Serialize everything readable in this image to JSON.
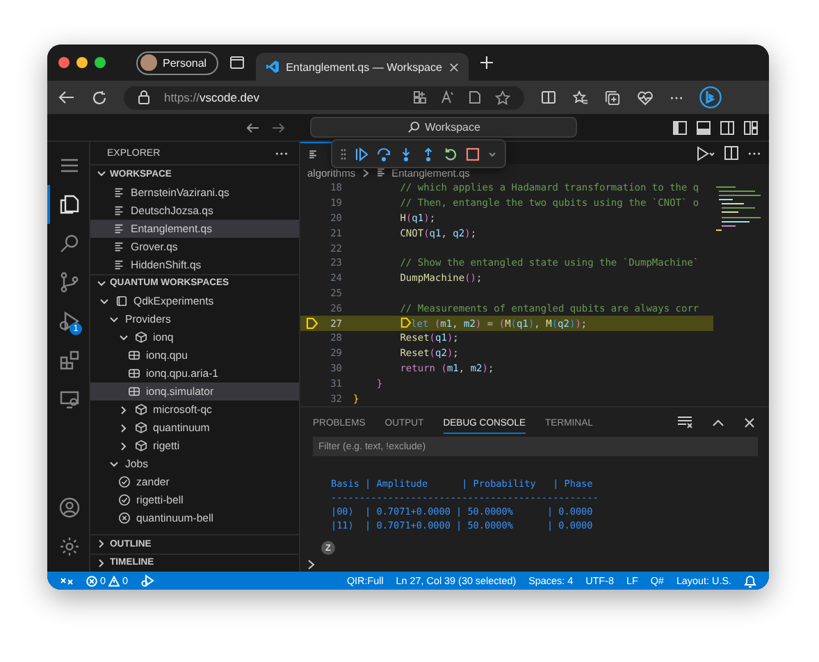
{
  "browser": {
    "profile": "Personal",
    "tabs": [
      {
        "title": "Entanglement.qs — Workspace",
        "selected": true
      }
    ],
    "url_scheme": "https://",
    "url_host": "vscode.dev"
  },
  "titlebar": {
    "command_center": "Workspace"
  },
  "activity_bar": {
    "top": [
      {
        "kind": "menu",
        "selected": false
      },
      {
        "kind": "explorer",
        "selected": true
      },
      {
        "kind": "search",
        "selected": false
      },
      {
        "kind": "source-control",
        "selected": false
      },
      {
        "kind": "run-debug",
        "selected": false,
        "badge": "1"
      },
      {
        "kind": "extensions",
        "selected": false
      },
      {
        "kind": "remote",
        "selected": false
      }
    ],
    "bottom": [
      {
        "kind": "account",
        "selected": false
      },
      {
        "kind": "settings",
        "selected": false
      }
    ]
  },
  "sidebar": {
    "title": "EXPLORER",
    "sections": [
      {
        "title": "WORKSPACE",
        "expanded": true,
        "items": [
          {
            "label": "BernsteinVazirani.qs",
            "kind": "file",
            "selected": false
          },
          {
            "label": "DeutschJozsa.qs",
            "kind": "file",
            "selected": false
          },
          {
            "label": "Entanglement.qs",
            "kind": "file",
            "selected": true
          },
          {
            "label": "Grover.qs",
            "kind": "file",
            "selected": false
          },
          {
            "label": "HiddenShift.qs",
            "kind": "file",
            "selected": false
          }
        ]
      },
      {
        "title": "QUANTUM WORKSPACES",
        "expanded": true,
        "items": [
          {
            "label": "QdkExperiments",
            "kind": "workspace",
            "selected": false,
            "expanded": true,
            "children": [
              {
                "label": "Providers",
                "kind": "folder",
                "selected": false,
                "expanded": true,
                "children": [
                  {
                    "label": "ionq",
                    "kind": "provider",
                    "selected": false,
                    "expanded": true,
                    "children": [
                      {
                        "label": "ionq.qpu",
                        "kind": "target",
                        "selected": false
                      },
                      {
                        "label": "ionq.qpu.aria-1",
                        "kind": "target",
                        "selected": false
                      },
                      {
                        "label": "ionq.simulator",
                        "kind": "target",
                        "selected": true
                      }
                    ]
                  },
                  {
                    "label": "microsoft-qc",
                    "kind": "provider",
                    "selected": false,
                    "expanded": false
                  },
                  {
                    "label": "quantinuum",
                    "kind": "provider",
                    "selected": false,
                    "expanded": false
                  },
                  {
                    "label": "rigetti",
                    "kind": "provider",
                    "selected": false,
                    "expanded": false
                  }
                ]
              },
              {
                "label": "Jobs",
                "kind": "folder",
                "selected": false,
                "expanded": true,
                "children": [
                  {
                    "label": "zander",
                    "kind": "job-succeeded",
                    "selected": false
                  },
                  {
                    "label": "rigetti-bell",
                    "kind": "job-succeeded",
                    "selected": false
                  },
                  {
                    "label": "quantinuum-bell",
                    "kind": "job-failed",
                    "selected": false
                  }
                ]
              }
            ]
          }
        ]
      },
      {
        "title": "OUTLINE",
        "expanded": false
      },
      {
        "title": "TIMELINE",
        "expanded": false
      }
    ]
  },
  "editor": {
    "breadcrumbs": [
      "algorithms",
      "Entanglement.qs"
    ],
    "lines": [
      {
        "number": "18",
        "current": false,
        "tokens": [
          {
            "kind": "comment",
            "text": "        // which applies a Hadamard transformation to the q"
          }
        ]
      },
      {
        "number": "19",
        "current": false,
        "tokens": [
          {
            "kind": "comment",
            "text": "        // Then, entangle the two qubits using the `CNOT` o"
          }
        ]
      },
      {
        "number": "20",
        "current": false,
        "tokens": [
          {
            "kind": "function",
            "text": "        H"
          },
          {
            "kind": "bracket2",
            "text": "("
          },
          {
            "kind": "variable",
            "text": "q1"
          },
          {
            "kind": "bracket2",
            "text": ")"
          },
          {
            "kind": "plain",
            "text": ";"
          }
        ]
      },
      {
        "number": "21",
        "current": false,
        "tokens": [
          {
            "kind": "function",
            "text": "        CNOT"
          },
          {
            "kind": "bracket2",
            "text": "("
          },
          {
            "kind": "variable",
            "text": "q1"
          },
          {
            "kind": "plain",
            "text": ", "
          },
          {
            "kind": "variable",
            "text": "q2"
          },
          {
            "kind": "bracket2",
            "text": ")"
          },
          {
            "kind": "plain",
            "text": ";"
          }
        ]
      },
      {
        "number": "22",
        "current": false
      },
      {
        "number": "23",
        "current": false,
        "tokens": [
          {
            "kind": "comment",
            "text": "        // Show the entangled state using the `DumpMachine`"
          }
        ]
      },
      {
        "number": "24",
        "current": false,
        "tokens": [
          {
            "kind": "function",
            "text": "        DumpMachine"
          },
          {
            "kind": "bracket2",
            "text": "()"
          },
          {
            "kind": "plain",
            "text": ";"
          }
        ]
      },
      {
        "number": "25",
        "current": false
      },
      {
        "number": "26",
        "current": false,
        "tokens": [
          {
            "kind": "comment",
            "text": "        // Measurements of entangled qubits are always corr"
          }
        ]
      },
      {
        "number": "27",
        "current": true,
        "tokens": [
          {
            "kind": "stop-marker"
          },
          {
            "kind": "keyword",
            "text": "let "
          },
          {
            "kind": "bracket2",
            "text": "("
          },
          {
            "kind": "variable",
            "text": "m1"
          },
          {
            "kind": "plain",
            "text": ", "
          },
          {
            "kind": "variable",
            "text": "m2"
          },
          {
            "kind": "bracket2",
            "text": ")"
          },
          {
            "kind": "plain",
            "text": " = "
          },
          {
            "kind": "bracket2",
            "text": "("
          },
          {
            "kind": "function",
            "text": "M"
          },
          {
            "kind": "bracket3",
            "text": "("
          },
          {
            "kind": "variable",
            "text": "q1"
          },
          {
            "kind": "bracket3",
            "text": ")"
          },
          {
            "kind": "plain",
            "text": ", "
          },
          {
            "kind": "function",
            "text": "M"
          },
          {
            "kind": "bracket3",
            "text": "("
          },
          {
            "kind": "variable",
            "text": "q2"
          },
          {
            "kind": "bracket3",
            "text": ")"
          },
          {
            "kind": "bracket2",
            "text": ")"
          },
          {
            "kind": "plain",
            "text": ";"
          }
        ]
      },
      {
        "number": "28",
        "current": false,
        "tokens": [
          {
            "kind": "function",
            "text": "        Reset"
          },
          {
            "kind": "bracket2",
            "text": "("
          },
          {
            "kind": "variable",
            "text": "q1"
          },
          {
            "kind": "bracket2",
            "text": ")"
          },
          {
            "kind": "plain",
            "text": ";"
          }
        ]
      },
      {
        "number": "29",
        "current": false,
        "tokens": [
          {
            "kind": "function",
            "text": "        Reset"
          },
          {
            "kind": "bracket2",
            "text": "("
          },
          {
            "kind": "variable",
            "text": "q2"
          },
          {
            "kind": "bracket2",
            "text": ")"
          },
          {
            "kind": "plain",
            "text": ";"
          }
        ]
      },
      {
        "number": "30",
        "current": false,
        "tokens": [
          {
            "kind": "control",
            "text": "        return "
          },
          {
            "kind": "bracket2",
            "text": "("
          },
          {
            "kind": "variable",
            "text": "m1"
          },
          {
            "kind": "plain",
            "text": ", "
          },
          {
            "kind": "variable",
            "text": "m2"
          },
          {
            "kind": "bracket2",
            "text": ")"
          },
          {
            "kind": "plain",
            "text": ";"
          }
        ]
      },
      {
        "number": "31",
        "current": false,
        "tokens": [
          {
            "kind": "bracket2",
            "text": "    }"
          }
        ]
      },
      {
        "number": "32",
        "current": false,
        "tokens": [
          {
            "kind": "bracket1",
            "text": "}"
          }
        ]
      }
    ]
  },
  "panel": {
    "tabs": [
      {
        "label": "PROBLEMS",
        "selected": false
      },
      {
        "label": "OUTPUT",
        "selected": false
      },
      {
        "label": "DEBUG CONSOLE",
        "selected": true
      },
      {
        "label": "TERMINAL",
        "selected": false
      }
    ],
    "filter": {
      "placeholder": "Filter (e.g. text, !exclude)"
    },
    "console": [
      "Basis | Amplitude      | Probability   | Phase",
      "-----------------------------------------------",
      "|00⟩  | 0.7071+0.0000 | 50.0000%      | 0.0000",
      "|11⟩  | 0.7071+0.0000 | 50.0000%      | 0.0000"
    ],
    "badge": "Z"
  },
  "status_bar": {
    "errors": "0",
    "warnings": "0",
    "items": [
      "QIR:Full",
      "Ln 27, Col 39 (30 selected)",
      "Spaces: 4",
      "UTF-8",
      "LF",
      "Q#",
      "Layout: U.S."
    ]
  }
}
